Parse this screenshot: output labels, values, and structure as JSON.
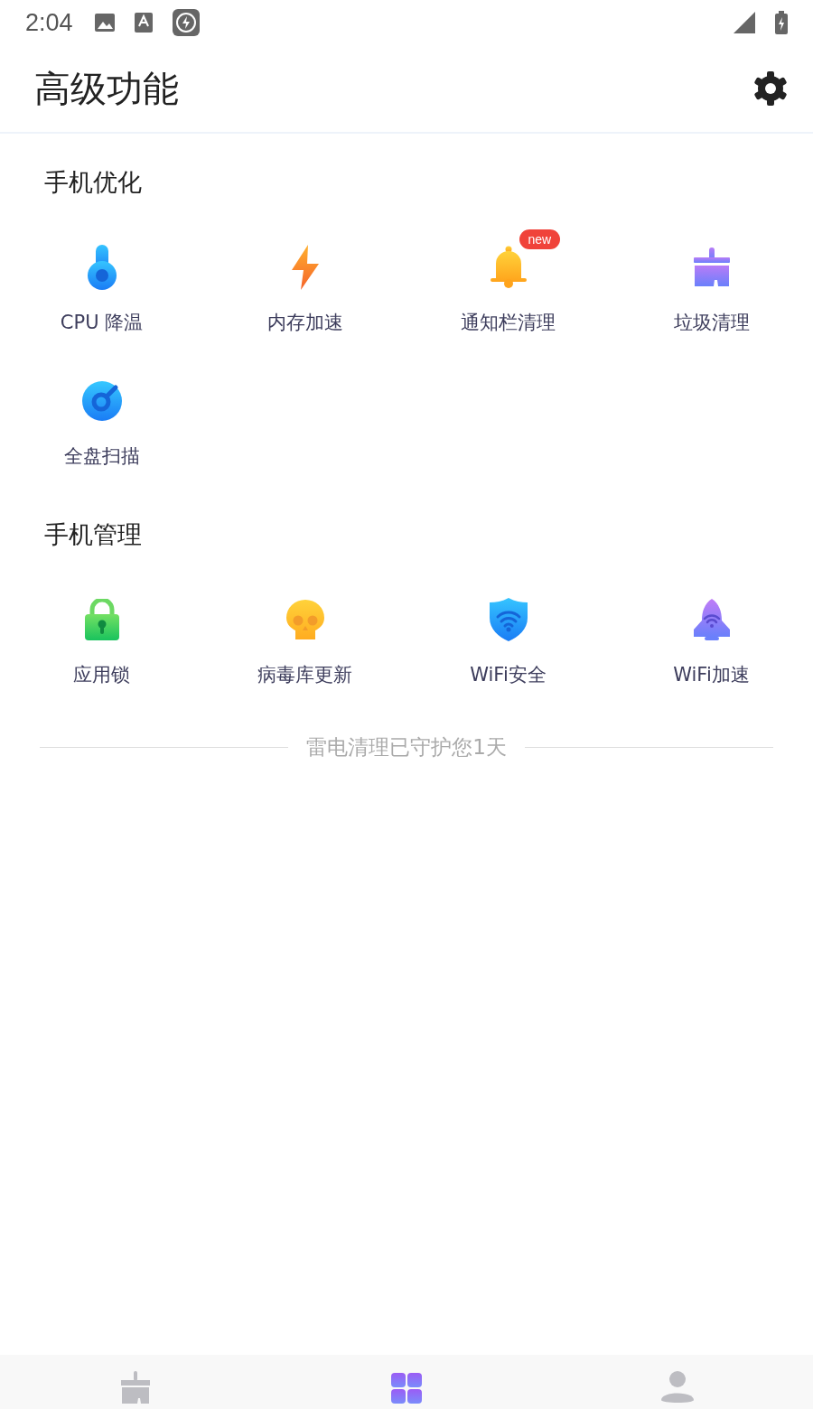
{
  "status_bar": {
    "time": "2:04"
  },
  "header": {
    "title": "高级功能"
  },
  "sections": [
    {
      "title": "手机优化",
      "items": [
        {
          "label": "CPU 降温"
        },
        {
          "label": "内存加速"
        },
        {
          "label": "通知栏清理",
          "badge": "new"
        },
        {
          "label": "垃圾清理"
        },
        {
          "label": "全盘扫描"
        }
      ]
    },
    {
      "title": "手机管理",
      "items": [
        {
          "label": "应用锁"
        },
        {
          "label": "病毒库更新"
        },
        {
          "label": "WiFi安全"
        },
        {
          "label": "WiFi加速"
        }
      ]
    }
  ],
  "footer_note": "雷电清理已守护您1天",
  "bottom_nav": [
    {
      "selected": false
    },
    {
      "selected": true
    },
    {
      "selected": false
    }
  ]
}
